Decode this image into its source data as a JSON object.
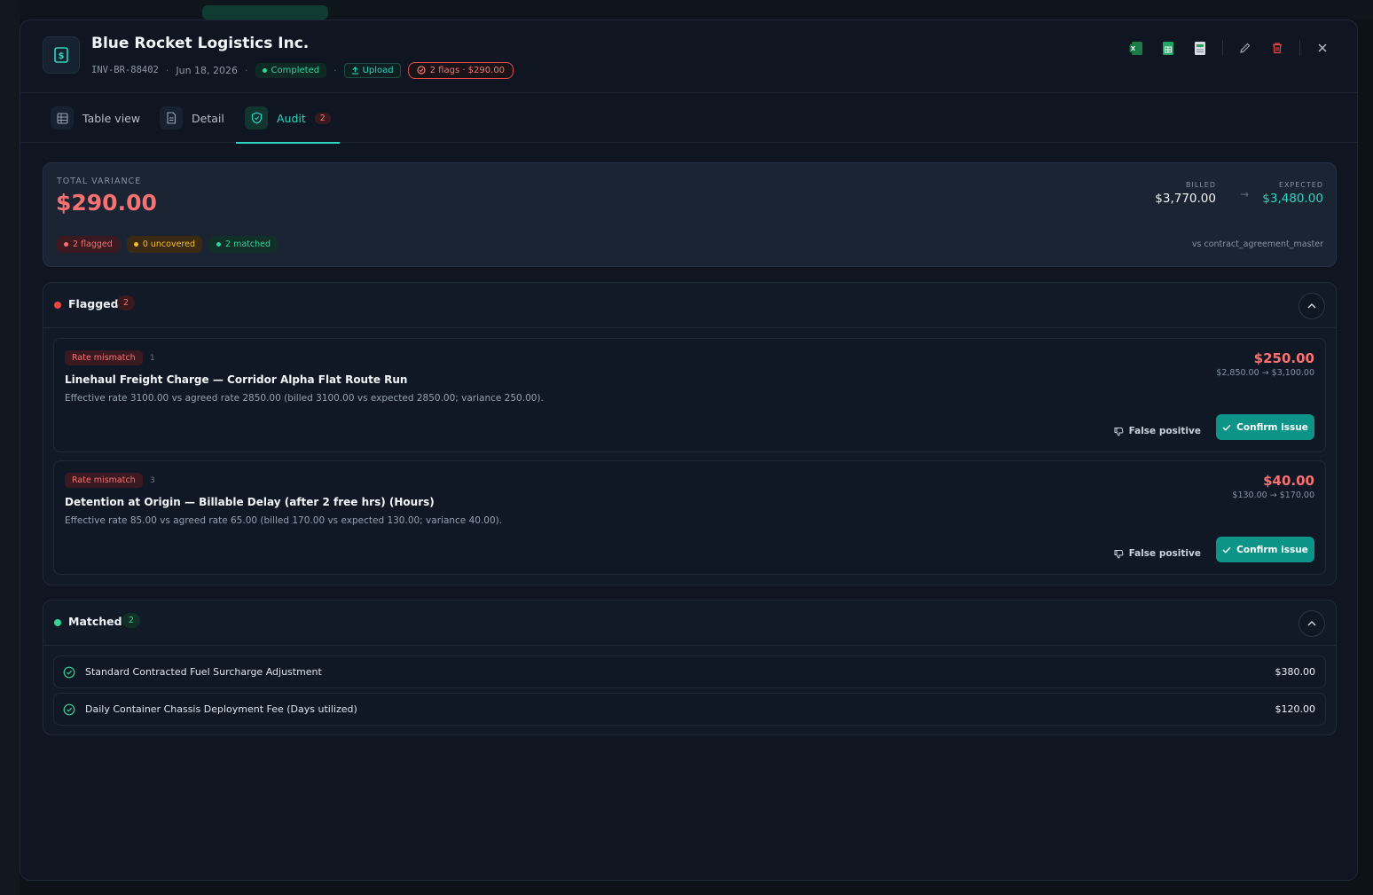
{
  "header": {
    "title": "Blue Rocket Logistics Inc.",
    "invoice_id": "INV-BR-88402",
    "date": "Jun 18, 2026",
    "status": "Completed",
    "source": "Upload",
    "flags_badge": "2 flags · $290.00",
    "actions": [
      "excel-icon",
      "sheets-icon",
      "doc-icon",
      "pencil-icon",
      "trash-icon",
      "close-icon"
    ]
  },
  "tabs": [
    {
      "label": "Table view",
      "icon": "table-icon"
    },
    {
      "label": "Detail",
      "icon": "document-icon"
    },
    {
      "label": "Audit",
      "icon": "shield-icon",
      "count": "2"
    }
  ],
  "summary": {
    "label": "TOTAL VARIANCE",
    "value": "$290.00",
    "pills": [
      "2 flagged",
      "0 uncovered",
      "2 matched"
    ],
    "billed_label": "BILLED",
    "billed_value": "$3,770.00",
    "expected_label": "EXPECTED",
    "expected_value": "$3,480.00",
    "contract": "vs contract_agreement_master"
  },
  "flagged": {
    "title": "Flagged",
    "count": "2",
    "items": [
      {
        "tag": "Rate mismatch",
        "index": "1",
        "title": "Linehaul Freight Charge — Corridor Alpha Flat Route Run",
        "description": "Effective rate 3100.00 vs agreed rate 2850.00 (billed 3100.00 vs expected 2850.00; variance 250.00).",
        "amount": "$250.00",
        "range": "$2,850.00 → $3,100.00",
        "false_positive": "False positive",
        "confirm": "Confirm issue"
      },
      {
        "tag": "Rate mismatch",
        "index": "3",
        "title": "Detention at Origin — Billable Delay (after 2 free hrs) (Hours)",
        "description": "Effective rate 85.00 vs agreed rate 65.00 (billed 170.00 vs expected 130.00; variance 40.00).",
        "amount": "$40.00",
        "range": "$130.00 → $170.00",
        "false_positive": "False positive",
        "confirm": "Confirm issue"
      }
    ]
  },
  "matched": {
    "title": "Matched",
    "count": "2",
    "items": [
      {
        "label": "Standard Contracted Fuel Surcharge Adjustment",
        "value": "$380.00"
      },
      {
        "label": "Daily Container Chassis Deployment Fee (Days utilized)",
        "value": "$120.00"
      }
    ]
  },
  "colors": {
    "accent": "#2dd4bf",
    "danger": "#f87171",
    "warning": "#fbbf24",
    "success": "#34d399",
    "confirm_bg": "#0d9488"
  }
}
